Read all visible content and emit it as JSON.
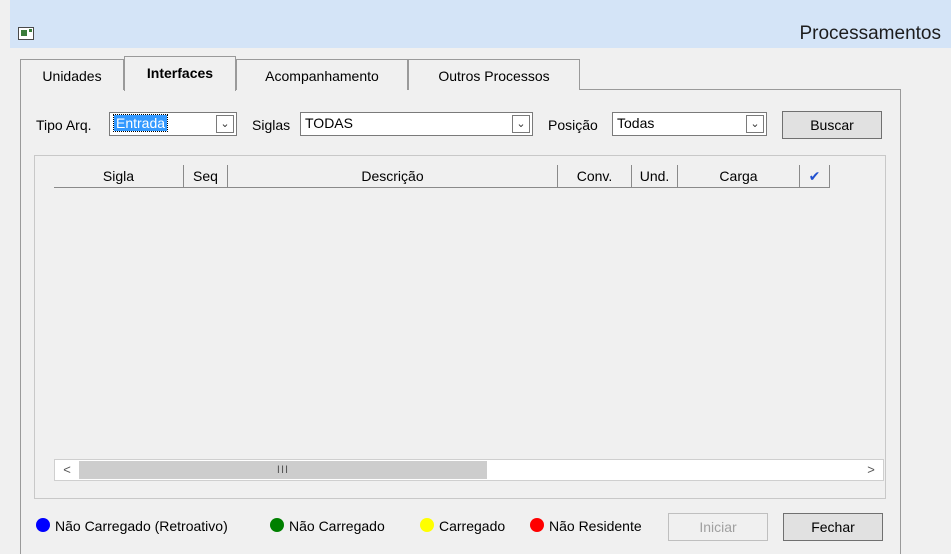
{
  "window": {
    "title": "Processamentos"
  },
  "tabs": [
    {
      "label": "Unidades"
    },
    {
      "label": "Interfaces"
    },
    {
      "label": "Acompanhamento"
    },
    {
      "label": "Outros Processos"
    }
  ],
  "filters": {
    "tipo_arq_label": "Tipo Arq.",
    "tipo_arq_value": "Entrada",
    "siglas_label": "Siglas",
    "siglas_value": "TODAS",
    "posicao_label": "Posição",
    "posicao_value": "Todas",
    "buscar_label": "Buscar"
  },
  "grid": {
    "columns": [
      "Sigla",
      "Seq",
      "Descrição",
      "Conv.",
      "Und.",
      "Carga",
      "✔"
    ],
    "rows": []
  },
  "scrollbar": {
    "left_arrow": "<",
    "right_arrow": ">",
    "thumb_grip": "III"
  },
  "legend": [
    {
      "label": "Não Carregado (Retroativo)",
      "color": "#0000ff"
    },
    {
      "label": "Não Carregado",
      "color": "#008000"
    },
    {
      "label": "Carregado",
      "color": "#ffff00"
    },
    {
      "label": "Não Residente",
      "color": "#ff0000"
    }
  ],
  "actions": {
    "iniciar_label": "Iniciar",
    "fechar_label": "Fechar"
  },
  "colors": {
    "titlebar": "#d4e4f7",
    "selection": "#3399ff"
  }
}
